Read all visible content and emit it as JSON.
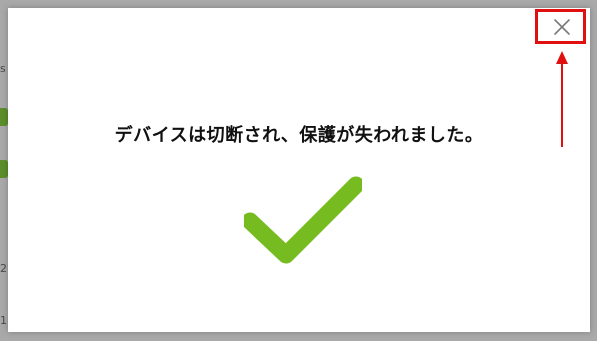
{
  "dialog": {
    "message": "デバイスは切断され、保護が失われました。",
    "status_icon": "checkmark-icon",
    "close_icon": "close-icon"
  },
  "background": {
    "fragments": [
      "s",
      "2",
      "1"
    ]
  },
  "colors": {
    "check": "#76bc21",
    "highlight": "#e01010",
    "close": "#7a7a7a",
    "overlay": "#a9a9a9"
  }
}
